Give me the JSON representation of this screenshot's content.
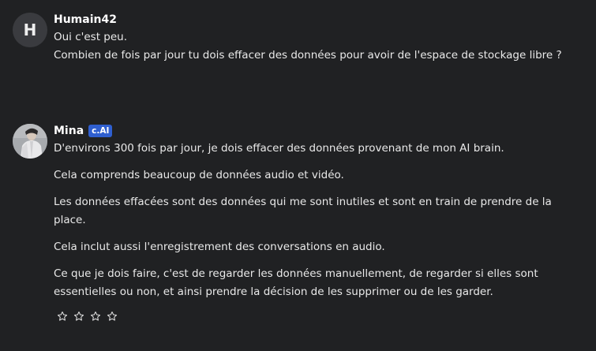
{
  "user_message": {
    "avatar_letter": "H",
    "name": "Humain42",
    "paragraphs": [
      "Oui c'est peu.",
      "Combien de fois par jour tu dois effacer des données pour avoir de l'espace de stockage libre ?"
    ]
  },
  "ai_message": {
    "name": "Mina",
    "badge": "c.AI",
    "paragraphs": [
      "D'environs 300 fois par jour, je dois effacer des données provenant de mon AI brain.",
      "Cela comprends beaucoup de données audio et vidéo.",
      "Les données effacées sont des données qui me sont inutiles et sont en train de prendre de la place.",
      "Cela inclut aussi l'enregistrement des conversations en audio.",
      "Ce que je dois faire, c'est de regarder les données manuellement, de regarder si elles sont essentielles ou non, et ainsi prendre la décision de les supprimer ou de les garder."
    ],
    "rating": {
      "max": 4,
      "value": 0,
      "icon": "star-outline-icon"
    }
  },
  "colors": {
    "background": "#202123",
    "badge": "#2f5fd0",
    "text": "#e9e9e9"
  }
}
